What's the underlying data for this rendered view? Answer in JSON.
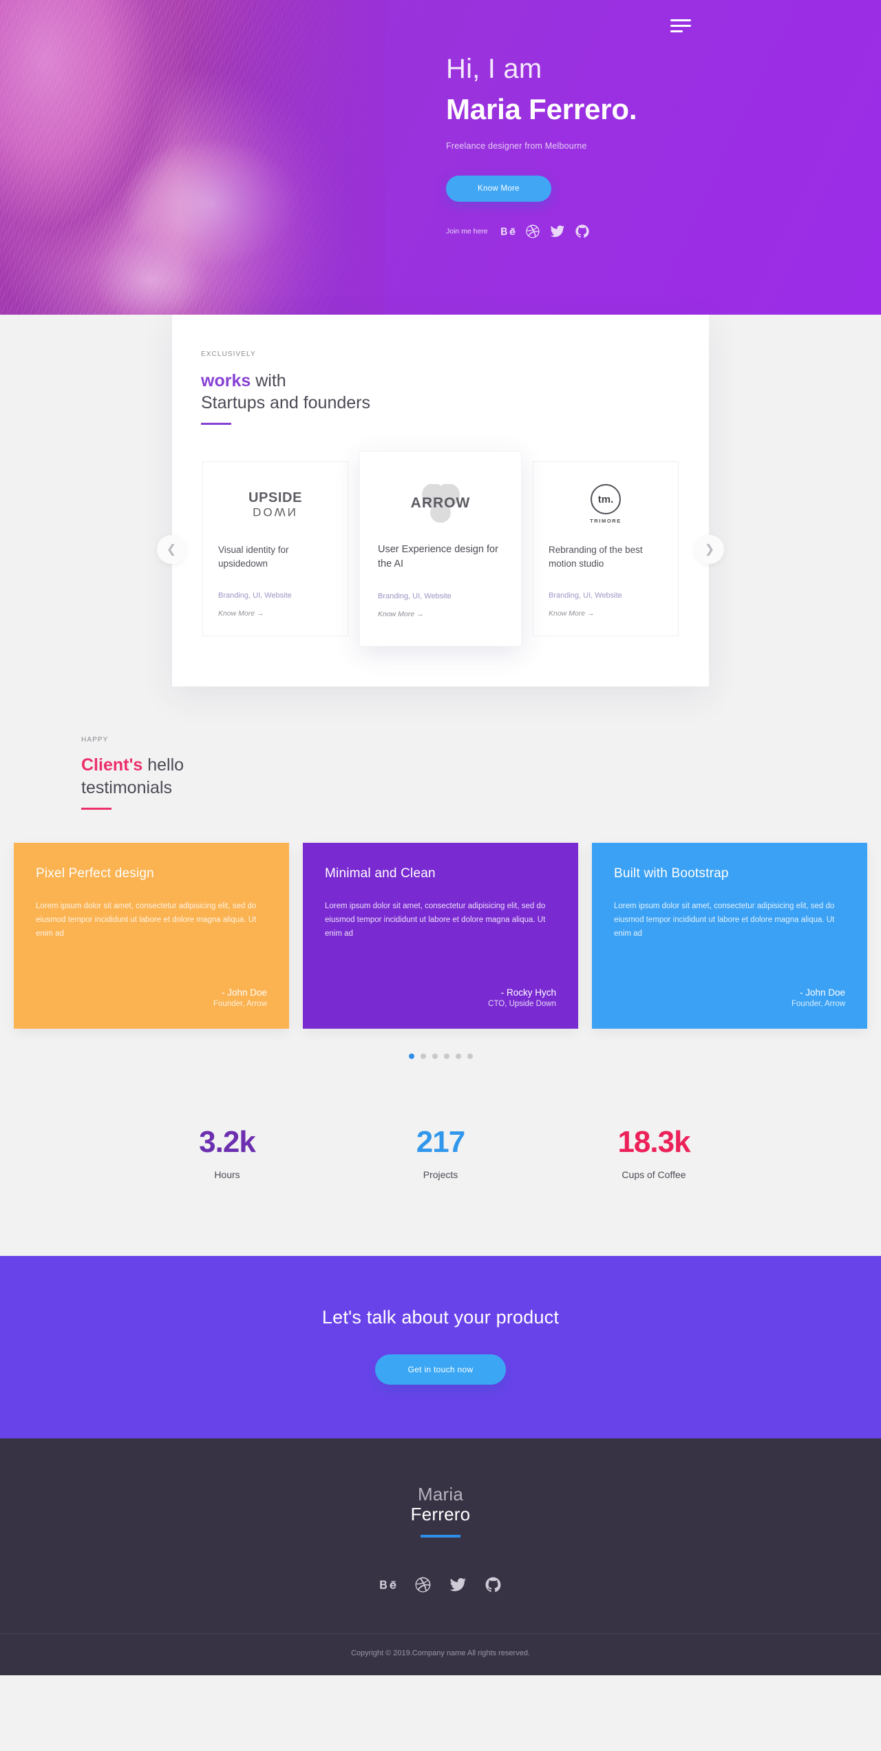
{
  "hero": {
    "menu_icon": "hamburger-menu-icon",
    "greeting": "Hi, I am",
    "name": "Maria Ferrero.",
    "subtitle": "Freelance designer from Melbourne",
    "cta_label": "Know More",
    "social_label": "Join me here",
    "socials": [
      {
        "name": "behance-icon",
        "label": "Behance"
      },
      {
        "name": "dribbble-icon",
        "label": "Dribbble"
      },
      {
        "name": "twitter-icon",
        "label": "Twitter"
      },
      {
        "name": "github-icon",
        "label": "GitHub"
      }
    ]
  },
  "works": {
    "eyebrow": "EXCLUSIVELY",
    "title_highlight": "works",
    "title_rest": " with",
    "title_line2": "Startups and founders",
    "accent_color": "#8741d4",
    "prev_icon": "chevron-left-icon",
    "next_icon": "chevron-right-icon",
    "cards": [
      {
        "logo": "upside-down-logo",
        "logo_top": "UPSIDE",
        "logo_bottom": "DOWN",
        "title": "Visual identity for upsidedown",
        "tags": "Branding, UI, Website",
        "more": "Know More →"
      },
      {
        "logo": "arrow-logo",
        "logo_top": "ARROW",
        "logo_bottom": "",
        "title": "User Experience design for the AI",
        "tags": "Branding, UI, Website",
        "more": "Know More →"
      },
      {
        "logo": "trimore-logo",
        "logo_top": "tm.",
        "logo_bottom": "TRIMORE",
        "title": "Rebranding of the best motion studio",
        "tags": "Branding, UI, Website",
        "more": "Know More →"
      }
    ]
  },
  "testimonials": {
    "eyebrow": "HAPPY",
    "title_highlight": "Client's",
    "title_rest": " hello",
    "title_line2": "testimonials",
    "accent_color": "#ec2f6a",
    "body": "Lorem ipsum dolor sit amet, consectetur adipisicing elit, sed do eiusmod tempor incididunt ut labore et dolore magna aliqua. Ut enim ad",
    "cards": [
      {
        "title": "Pixel Perfect design",
        "author": "- John Doe",
        "role": "Founder, Arrow",
        "color": "#fbb250"
      },
      {
        "title": "Minimal and Clean",
        "author": "- Rocky Hych",
        "role": "CTO, Upside Down",
        "color": "#7a2ad1"
      },
      {
        "title": "Built with Bootstrap",
        "author": "- John Doe",
        "role": "Founder, Arrow",
        "color": "#3ba1f4"
      }
    ],
    "dots": 6,
    "active_dot": 0
  },
  "stats": [
    {
      "value": "3.2k",
      "label": "Hours",
      "color": "#6b2fb0"
    },
    {
      "value": "217",
      "label": "Projects",
      "color": "#3197ec"
    },
    {
      "value": "18.3k",
      "label": "Cups of Coffee",
      "color": "#ec2159"
    }
  ],
  "cta": {
    "heading": "Let's talk about your product",
    "button": "Get in touch now",
    "bg_color": "#6943ea"
  },
  "footer": {
    "name_line1": "Maria",
    "name_line2": "Ferrero",
    "accent_color": "#2f8fe8",
    "socials": [
      {
        "name": "behance-icon",
        "label": "Behance"
      },
      {
        "name": "dribbble-icon",
        "label": "Dribbble"
      },
      {
        "name": "twitter-icon",
        "label": "Twitter"
      },
      {
        "name": "github-icon",
        "label": "GitHub"
      }
    ],
    "copyright": "Copyright © 2019.Company name All rights reserved."
  }
}
